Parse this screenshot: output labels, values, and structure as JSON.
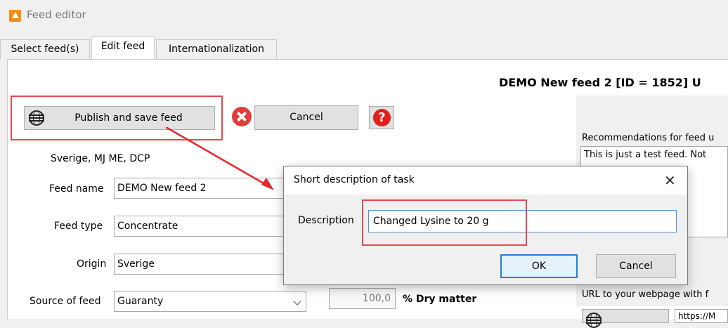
{
  "window": {
    "title": "Feed editor"
  },
  "tabs": [
    {
      "label": "Select feed(s)"
    },
    {
      "label": "Edit feed"
    },
    {
      "label": "Internationalization"
    }
  ],
  "header": {
    "feed_title": "DEMO New feed 2 [ID = 1852] U"
  },
  "toolbar": {
    "publish_label": "Publish and save feed",
    "cancel_label": "Cancel",
    "help_glyph": "?"
  },
  "form": {
    "region_text": "Sverige, MJ ME, DCP",
    "feed_name_label": "Feed name",
    "feed_name_value": "DEMO New feed 2",
    "feed_type_label": "Feed type",
    "feed_type_value": "Concentrate",
    "origin_label": "Origin",
    "origin_value": "Sverige",
    "source_label": "Source of feed",
    "source_value": "Guaranty",
    "dry_matter_value": "100,0",
    "dry_matter_label": "% Dry matter"
  },
  "right_panel": {
    "recommendations_label": "Recommendations for feed u",
    "recommendations_text": "This is just a test feed. Not",
    "url_label": "URL to your webpage with f",
    "url_value": "https://M"
  },
  "dialog": {
    "title": "Short description of task",
    "close_glyph": "✕",
    "description_label": "Description",
    "description_value": "Changed Lysine to 20 g",
    "ok_label": "OK",
    "cancel_label": "Cancel"
  },
  "colors": {
    "highlight": "#e8484f",
    "accent_blue": "#2b7fd0",
    "app_icon": "#f28c1a"
  },
  "icons": [
    "app-icon",
    "globe-icon",
    "cancel-icon",
    "help-icon",
    "close-icon",
    "chevron-down-icon"
  ]
}
